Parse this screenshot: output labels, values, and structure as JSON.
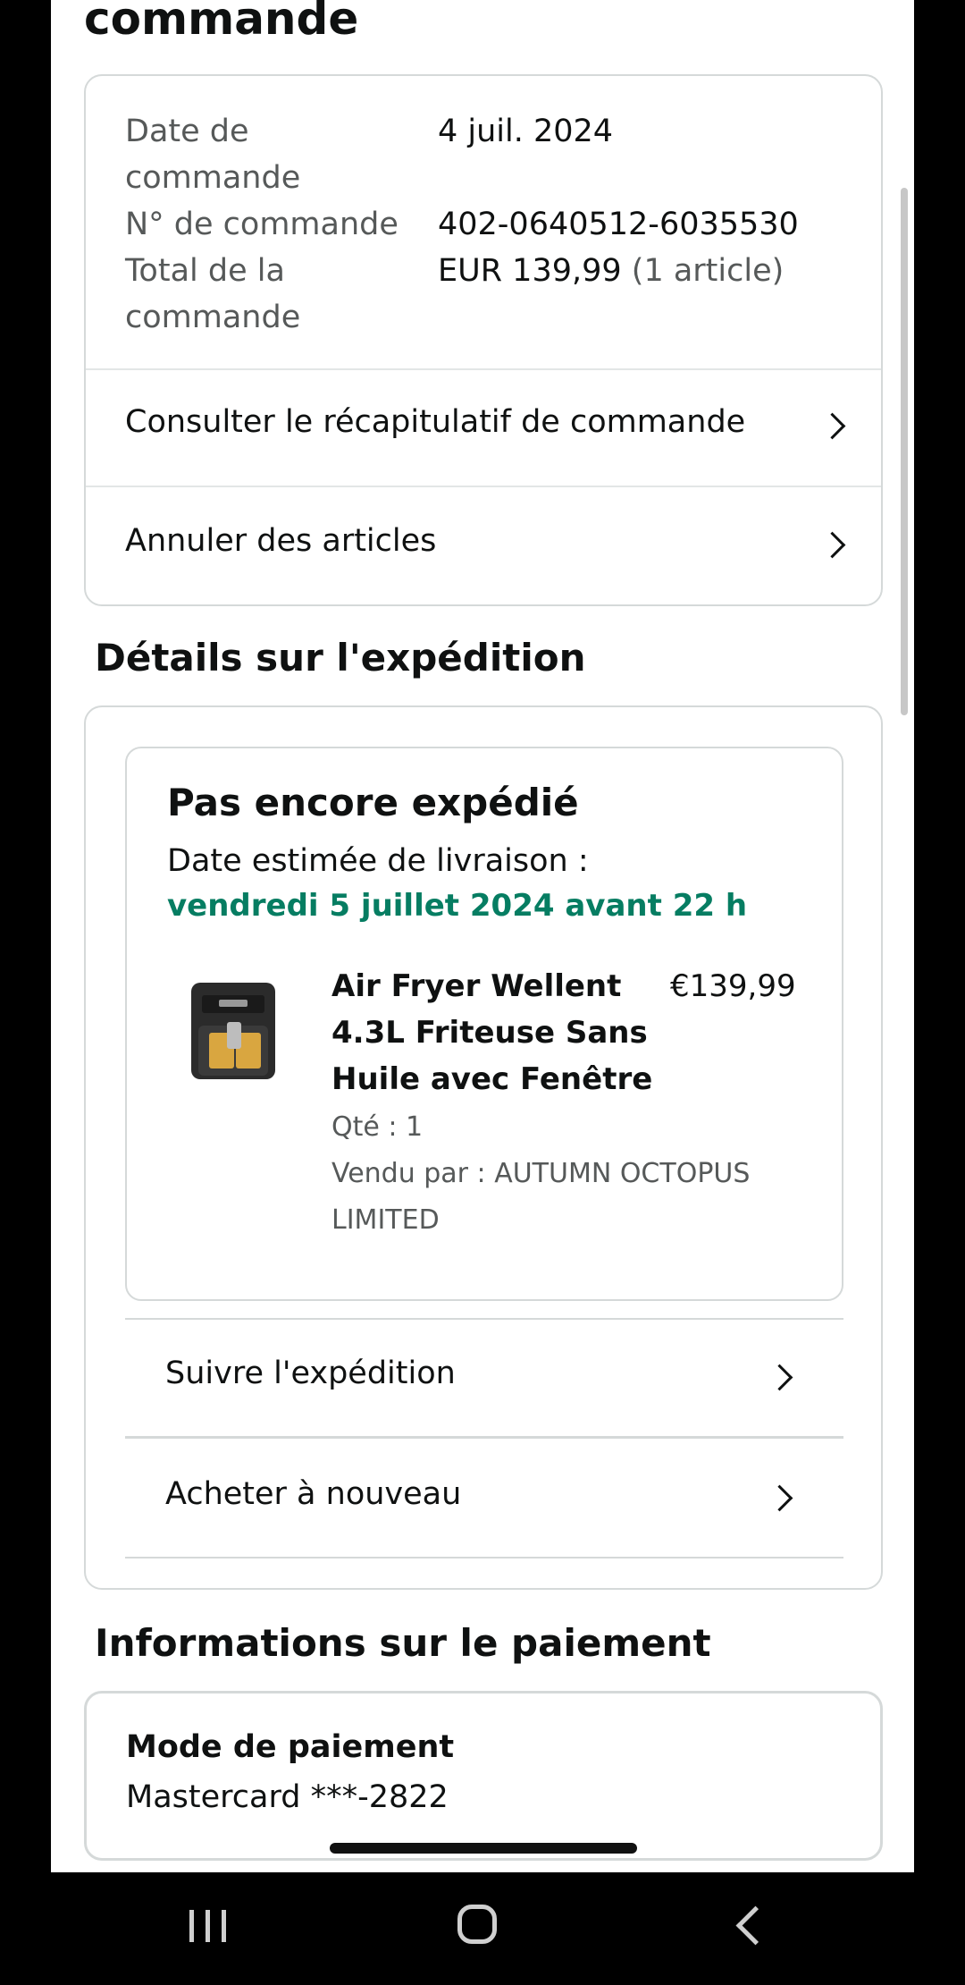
{
  "header": {
    "title": "commande"
  },
  "order_summary": {
    "date_label": "Date de commande",
    "date_value": "4 juil. 2024",
    "number_label": "N° de commande",
    "number_value": "402-0640512-6035530",
    "total_label": "Total de la commande",
    "total_value": "EUR 139,99",
    "total_items": "(1 article)",
    "actions": [
      {
        "label": "Consulter le récapitulatif de commande"
      },
      {
        "label": "Annuler des articles"
      }
    ]
  },
  "shipping": {
    "section_title": "Détails sur l'expédition",
    "status": "Pas encore expédié",
    "delivery_label": "Date estimée de livraison :",
    "delivery_date": "vendredi 5 juillet 2024 avant 22 h",
    "product": {
      "title": "Air Fryer Wellent 4.3L Friteuse Sans Huile avec Fenêtre",
      "price": "€139,99",
      "qty": "Qté : 1",
      "seller": "Vendu par : AUTUMN OCTOPUS LIMITED",
      "image_icon": "air-fryer-product-image"
    },
    "actions": [
      {
        "label": "Suivre l'expédition"
      },
      {
        "label": "Acheter à nouveau"
      }
    ]
  },
  "payment": {
    "section_title": "Informations sur le paiement",
    "method_label": "Mode de paiement",
    "method_value": "Mastercard ***-2822"
  },
  "colors": {
    "accent_green": "#067d62",
    "border": "#d5d9d9",
    "text": "#0f1111",
    "muted": "#565959"
  },
  "system_nav": {
    "recents_icon": "recent-apps-icon",
    "home_icon": "home-icon",
    "back_icon": "back-icon"
  }
}
